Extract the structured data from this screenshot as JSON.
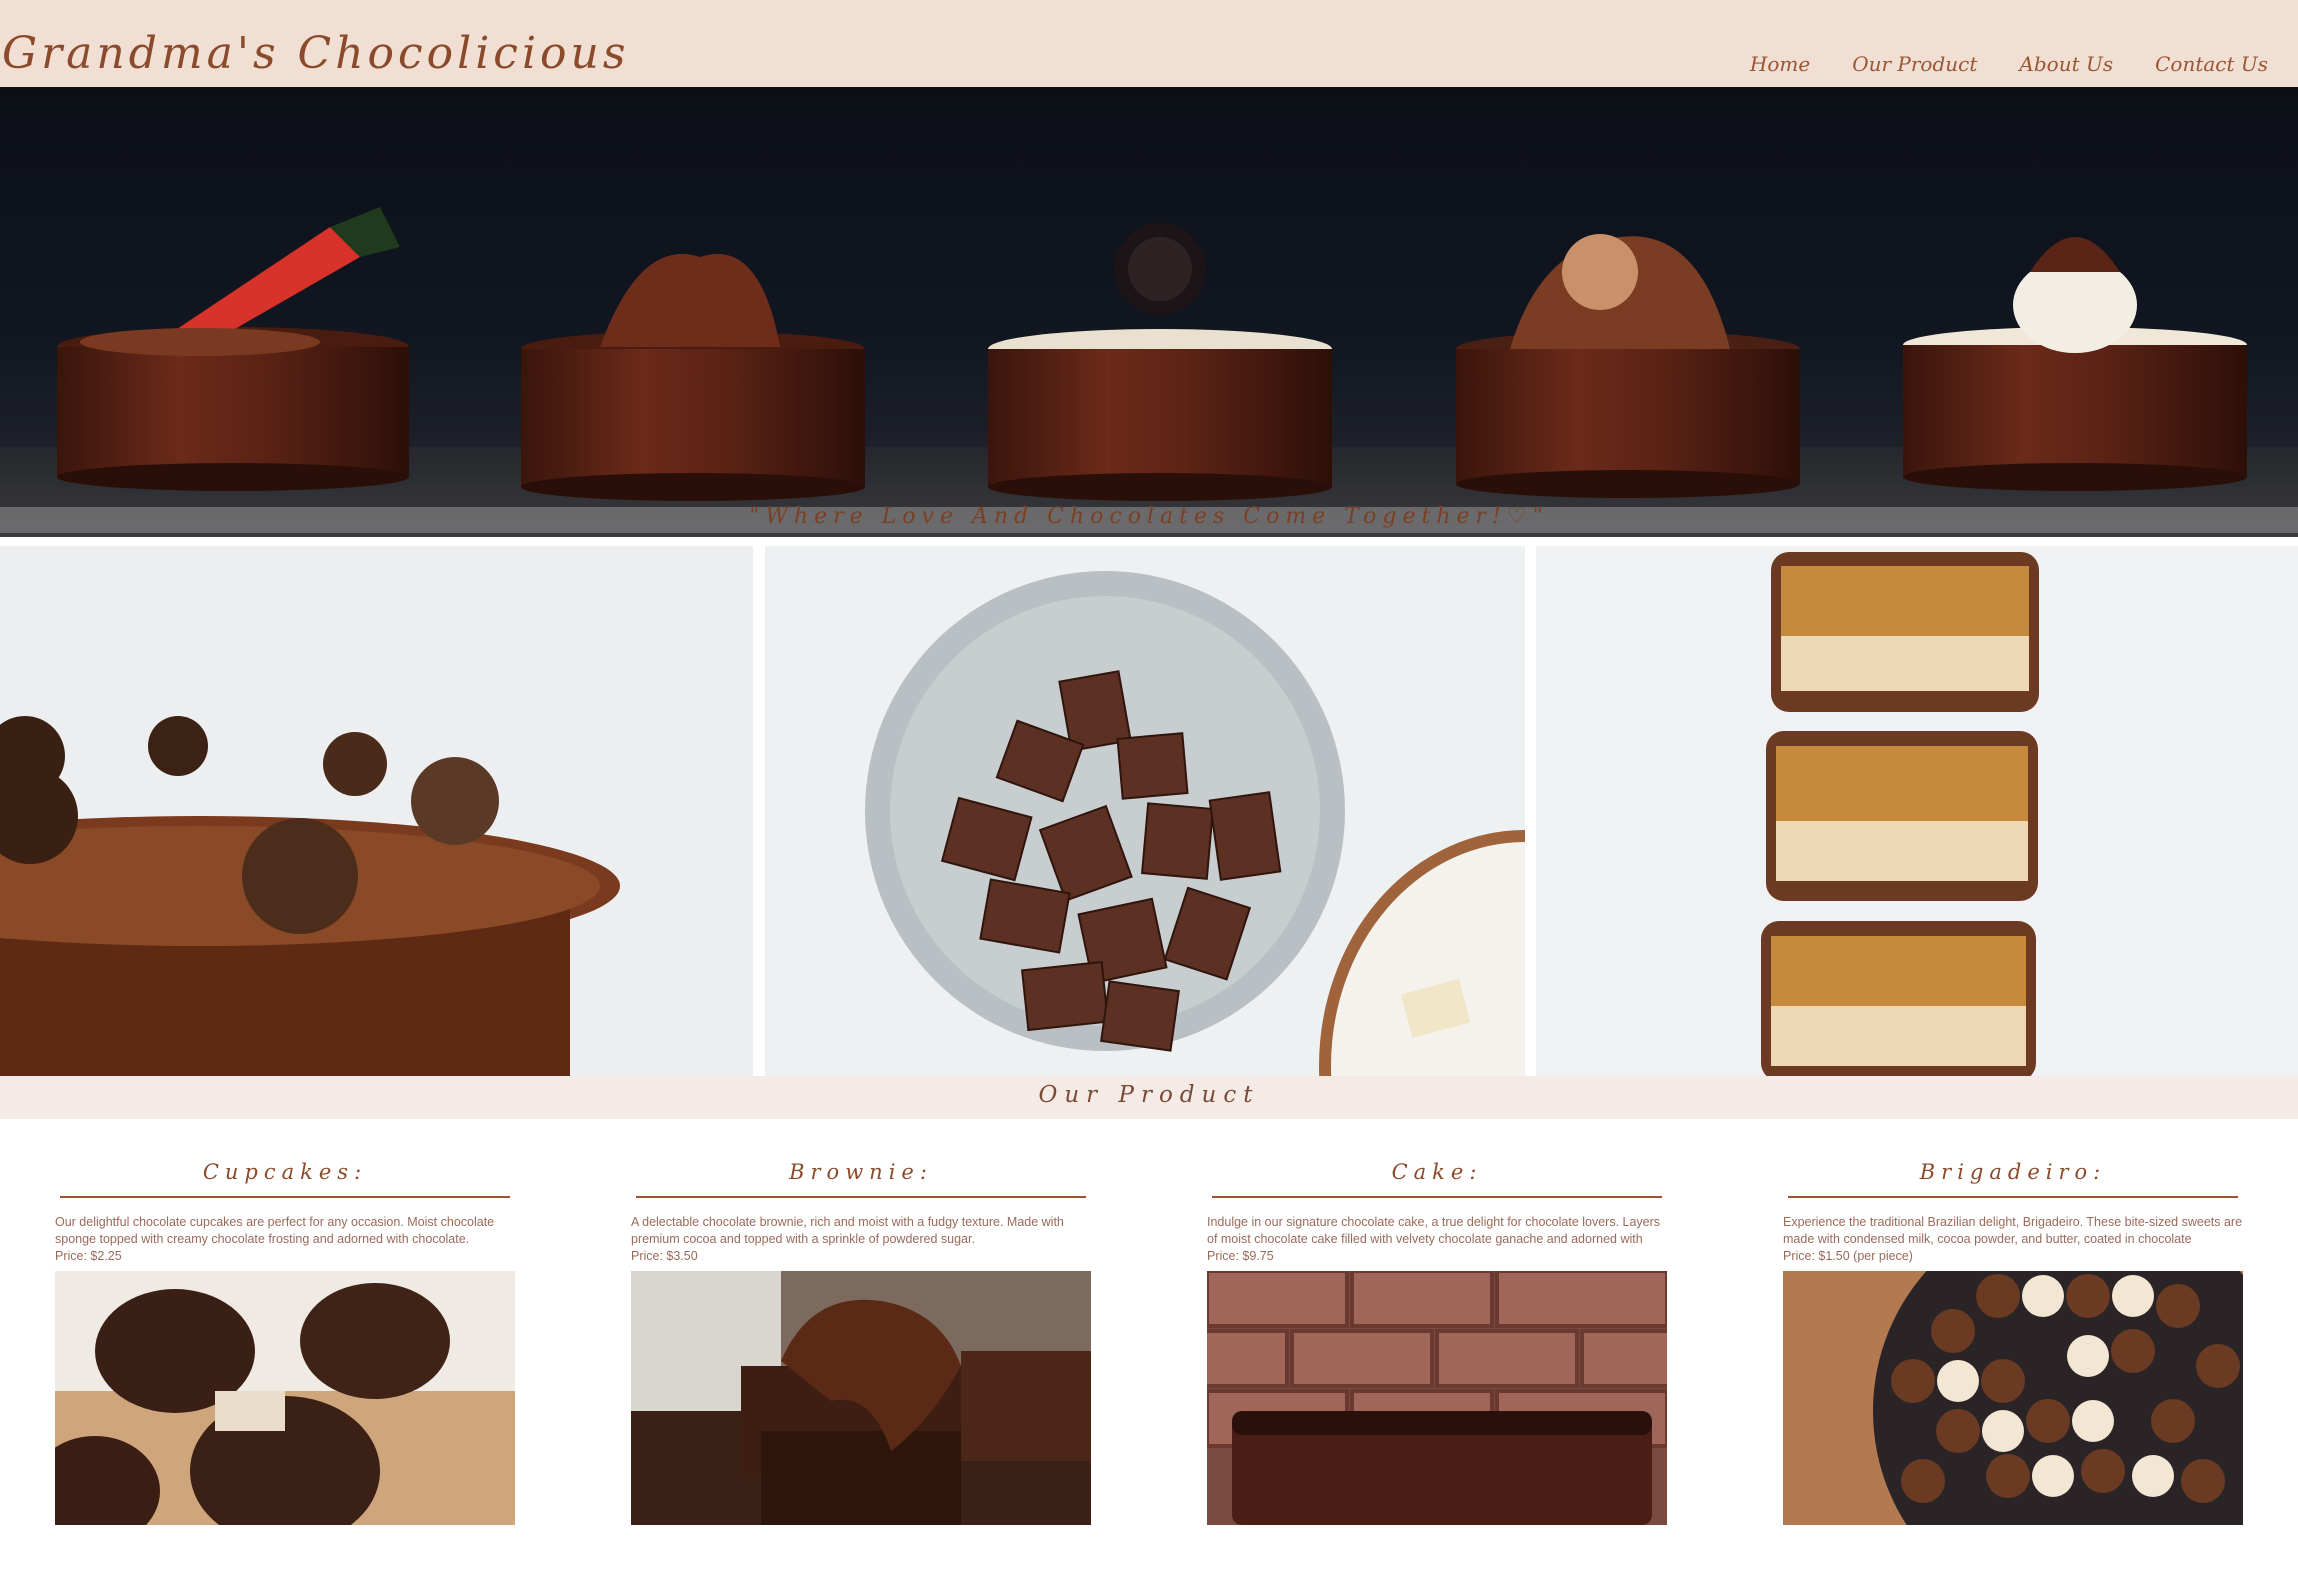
{
  "header": {
    "brand": "Grandma's Chocolicious",
    "nav": [
      {
        "label": "Home"
      },
      {
        "label": "Our Product"
      },
      {
        "label": "About Us"
      },
      {
        "label": "Contact Us"
      }
    ]
  },
  "hero": {
    "tagline": "\"Where Love And Chocolates Come Together!♡\""
  },
  "gallery": {
    "items": [
      {
        "icon": "chocolate-cake-truffles-image"
      },
      {
        "icon": "chocolate-pieces-bowl-image"
      },
      {
        "icon": "stacked-candy-bars-image"
      }
    ]
  },
  "products": {
    "section_title": "Our Product",
    "items": [
      {
        "title": "Cupcakes:",
        "description": "Our delightful chocolate cupcakes are perfect for any occasion. Moist chocolate sponge topped with creamy chocolate frosting and adorned with chocolate.",
        "price": "Price: $2.25",
        "icon": "chocolate-cupcakes-image"
      },
      {
        "title": "Brownie:",
        "description": "A delectable chocolate brownie, rich and moist with a fudgy texture. Made with premium cocoa and topped with a sprinkle of powdered sugar.",
        "price": "Price: $3.50",
        "icon": "brownie-image"
      },
      {
        "title": "Cake:",
        "description": "Indulge in our signature chocolate cake, a true delight for chocolate lovers. Layers of moist chocolate cake filled with velvety chocolate ganache and adorned with chocolate shavings.",
        "price": "Price: $9.75",
        "icon": "chocolate-cake-image"
      },
      {
        "title": "Brigadeiro:",
        "description": "Experience the traditional Brazilian delight, Brigadeiro. These bite-sized sweets are made with condensed milk, cocoa powder, and butter, coated in chocolate sprinkles. An irresistible treat!",
        "price": "Price: $1.50 (per piece)",
        "icon": "brigadeiro-platter-image"
      }
    ]
  },
  "colors": {
    "header_bg": "#f0dfd2",
    "brand_brown": "#8a4a2b",
    "text_muted": "#9a6a5a"
  }
}
